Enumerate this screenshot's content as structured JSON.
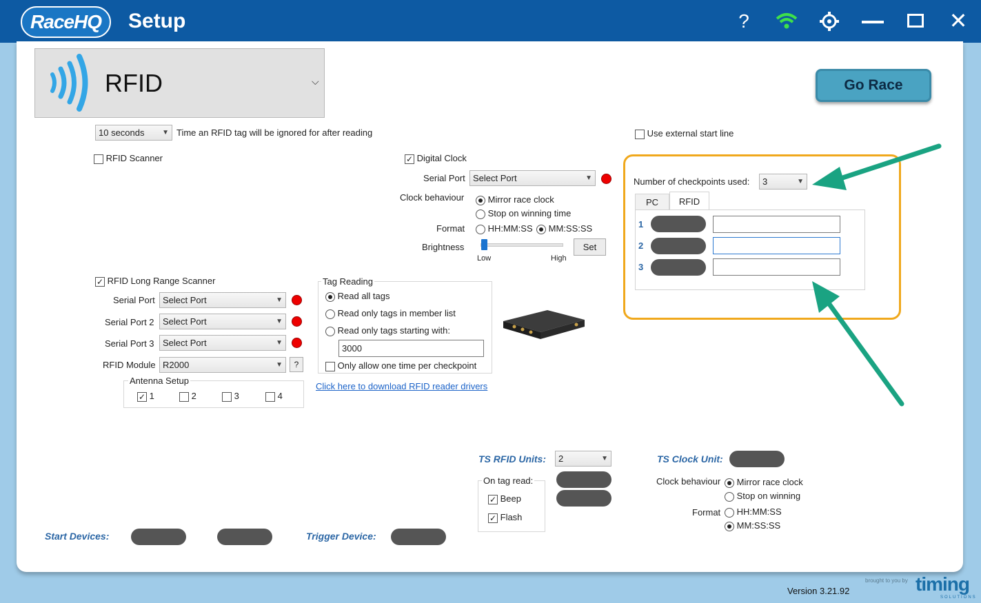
{
  "app": {
    "logo": "RaceHQ",
    "title": "Setup"
  },
  "titlebar_icons": [
    "help-icon",
    "wifi-icon",
    "settings-icon",
    "minimize-icon",
    "maximize-icon",
    "close-icon"
  ],
  "mode": {
    "label": "RFID",
    "icon": "rfid-waves-icon"
  },
  "go_race": "Go Race",
  "ignore_time": {
    "value": "10 seconds",
    "desc": "Time an RFID tag will be ignored for after reading"
  },
  "rfid_scanner": {
    "label": "RFID Scanner",
    "checked": false
  },
  "digital_clock": {
    "label": "Digital Clock",
    "checked": true,
    "serial_port_label": "Serial Port",
    "serial_port_value": "Select Port",
    "clock_behaviour_label": "Clock behaviour",
    "mirror": "Mirror race clock",
    "stop": "Stop on winning time",
    "format_label": "Format",
    "fmt1": "HH:MM:SS",
    "fmt2": "MM:SS:SS",
    "brightness_label": "Brightness",
    "low": "Low",
    "high": "High",
    "set": "Set"
  },
  "external_start": {
    "label": "Use external start line",
    "checked": false
  },
  "checkpoints": {
    "label": "Number of checkpoints used:",
    "value": "3",
    "tabs": [
      "PC",
      "RFID"
    ],
    "active_tab": "RFID",
    "rows": [
      "1",
      "2",
      "3"
    ]
  },
  "long_range": {
    "label": "RFID Long Range Scanner",
    "checked": true,
    "sp1_label": "Serial Port",
    "sp2_label": "Serial Port 2",
    "sp3_label": "Serial Port 3",
    "sp_value": "Select Port",
    "module_label": "RFID Module",
    "module_value": "R2000",
    "help": "?",
    "antenna_label": "Antenna Setup",
    "antennas": [
      "1",
      "2",
      "3",
      "4"
    ]
  },
  "tag_reading": {
    "label": "Tag Reading",
    "opt1": "Read all tags",
    "opt2": "Read only tags in member list",
    "opt3": "Read only tags starting with:",
    "prefix": "3000",
    "once": "Only allow one time per checkpoint"
  },
  "driver_link": "Click here to download RFID reader drivers",
  "ts_rfid": {
    "label": "TS RFID Units:",
    "value": "2",
    "on_tag_read": "On tag read:",
    "beep": "Beep",
    "flash": "Flash"
  },
  "ts_clock": {
    "label": "TS Clock Unit:",
    "behaviour_label": "Clock behaviour",
    "mirror": "Mirror race clock",
    "stop": "Stop on winning",
    "format_label": "Format",
    "fmt1": "HH:MM:SS",
    "fmt2": "MM:SS:SS"
  },
  "start_devices": "Start Devices:",
  "trigger_device": "Trigger Device:",
  "version": "Version 3.21.92",
  "brand": {
    "small": "brought to you by",
    "name": "timing",
    "sub": "SOLUTIONS"
  },
  "colors": {
    "titlebar": "#0d5aa3",
    "highlight": "#f0a81c",
    "arrow": "#1aa382",
    "led": "#e00000"
  }
}
